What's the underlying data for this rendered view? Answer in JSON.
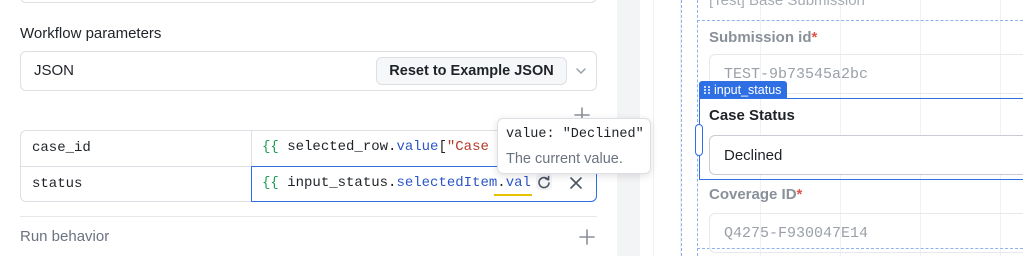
{
  "left_panel": {
    "workflow_parameters_title": "Workflow parameters",
    "format_select": {
      "value": "JSON",
      "reset_button_label": "Reset to Example JSON"
    },
    "parameters": [
      {
        "key": "case_id",
        "value_tokens": [
          {
            "t": "brace",
            "text": "{{ "
          },
          {
            "t": "ident",
            "text": "selected_row"
          },
          {
            "t": "ident",
            "text": "."
          },
          {
            "t": "prop",
            "text": "value"
          },
          {
            "t": "ident",
            "text": "["
          },
          {
            "t": "str",
            "text": "\"Case I"
          }
        ]
      },
      {
        "key": "status",
        "value_tokens": [
          {
            "t": "brace",
            "text": "{{ "
          },
          {
            "t": "ident",
            "text": "input_status"
          },
          {
            "t": "ident",
            "text": "."
          },
          {
            "t": "prop",
            "text": "selectedItem"
          },
          {
            "t": "ident",
            "text": "."
          },
          {
            "t": "prop",
            "text": "valu"
          }
        ]
      }
    ],
    "run_behavior_title": "Run behavior"
  },
  "tooltip": {
    "code": "value: \"Declined\"",
    "description": "The current value."
  },
  "canvas": {
    "top_faded_text": "[Test] Base Submission",
    "submission_label": "Submission id",
    "submission_value": "TEST-9b73545a2bc",
    "selected_component_tag": "input_status",
    "case_status_label": "Case Status",
    "case_status_value": "Declined",
    "coverage_label": "Coverage ID",
    "coverage_value": "Q4275-F930047E14",
    "required_marker": "*"
  },
  "colors": {
    "accent": "#2f6fe4",
    "required": "#e0534a",
    "template_brace": "#1f9d55",
    "template_property": "#2c56c7"
  }
}
